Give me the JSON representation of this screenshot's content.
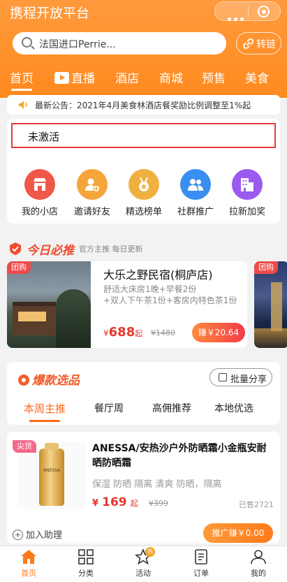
{
  "app": {
    "title": "携程开放平台"
  },
  "search": {
    "placeholder": "法国进口Perrie...",
    "transfer_label": "转链"
  },
  "nav_tabs": [
    "首页",
    "直播",
    "酒店",
    "商城",
    "预售",
    "美食"
  ],
  "announcement": "最新公告：2021年4月美食林酒店餐奖励比例调整至1%起",
  "status": {
    "inactive_label": "未激活"
  },
  "menu": [
    {
      "label": "我的小店",
      "icon": "shop-icon",
      "color": "#f0584a"
    },
    {
      "label": "邀请好友",
      "icon": "add-user-icon",
      "color": "#f5a53a"
    },
    {
      "label": "精选榜单",
      "icon": "medal-icon",
      "color": "#f0b040"
    },
    {
      "label": "社群推广",
      "icon": "group-icon",
      "color": "#3a8ef0"
    },
    {
      "label": "拉新加奖",
      "icon": "building-icon",
      "color": "#9a5af0"
    }
  ],
  "today": {
    "title": "今日必推",
    "subtitle": "官方主推  每日更新",
    "product": {
      "tag": "团购",
      "name": "大乐之野民宿(桐庐店)",
      "desc": "舒适大床房1晚+早餐2份\n+双人下午茶1份+客房内特色茶1份",
      "currency": "¥",
      "price": "688",
      "price_suffix": "起",
      "old_price": "¥1480",
      "earn_label": "赚￥20.64"
    },
    "next_tag": "团购"
  },
  "hot": {
    "title": "爆款选品",
    "batch_share": "批量分享",
    "tabs": [
      "本周主推",
      "餐厅周",
      "高佣推荐",
      "本地优选"
    ]
  },
  "item": {
    "tag": "尖货",
    "bottle_label": "ANESSA",
    "title": "ANESSA/安热沙户外防晒霜小金瓶安耐晒防晒霜",
    "tags": "保湿 防晒 隔离 清爽 防晒，隔离",
    "currency": "¥",
    "price": "169",
    "price_suffix": "起",
    "old_price": "¥399",
    "sold": "已售2721",
    "add_helper": "加入助理",
    "promo_label": "推广赚￥0.00"
  },
  "tabbar": [
    {
      "label": "首页",
      "icon": "home-icon",
      "active": true
    },
    {
      "label": "分类",
      "icon": "category-icon"
    },
    {
      "label": "活动",
      "icon": "star-icon",
      "badge": "热"
    },
    {
      "label": "订单",
      "icon": "order-icon"
    },
    {
      "label": "我的",
      "icon": "profile-icon"
    }
  ],
  "colors": {
    "primary": "#ff8a1f",
    "price_red": "#e5382f",
    "alert_border": "#e43a3a"
  }
}
